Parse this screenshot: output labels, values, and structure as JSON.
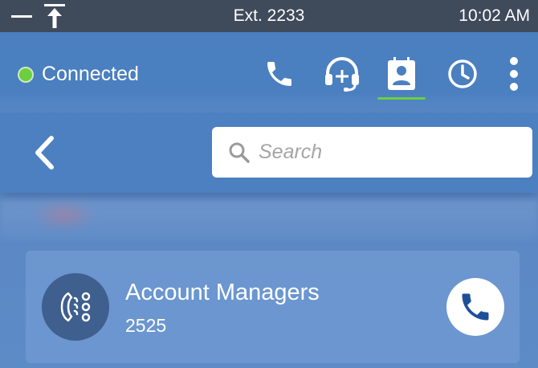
{
  "status_bar": {
    "extension": "Ext. 2233",
    "time": "10:02 AM"
  },
  "header": {
    "connection_status": "Connected",
    "status_color": "#6ccf3f",
    "toolbar": [
      "phone-icon",
      "headset-add-icon",
      "contacts-icon",
      "clock-icon",
      "more-vert-icon"
    ],
    "active_tab": "contacts-icon"
  },
  "search": {
    "placeholder": "Search",
    "value": ""
  },
  "contact": {
    "name": "Account Managers",
    "number": "2525"
  },
  "colors": {
    "accent_blue": "#4a7fc0",
    "status_bar": "#3f4a5b",
    "call_icon": "#1f4f99"
  }
}
